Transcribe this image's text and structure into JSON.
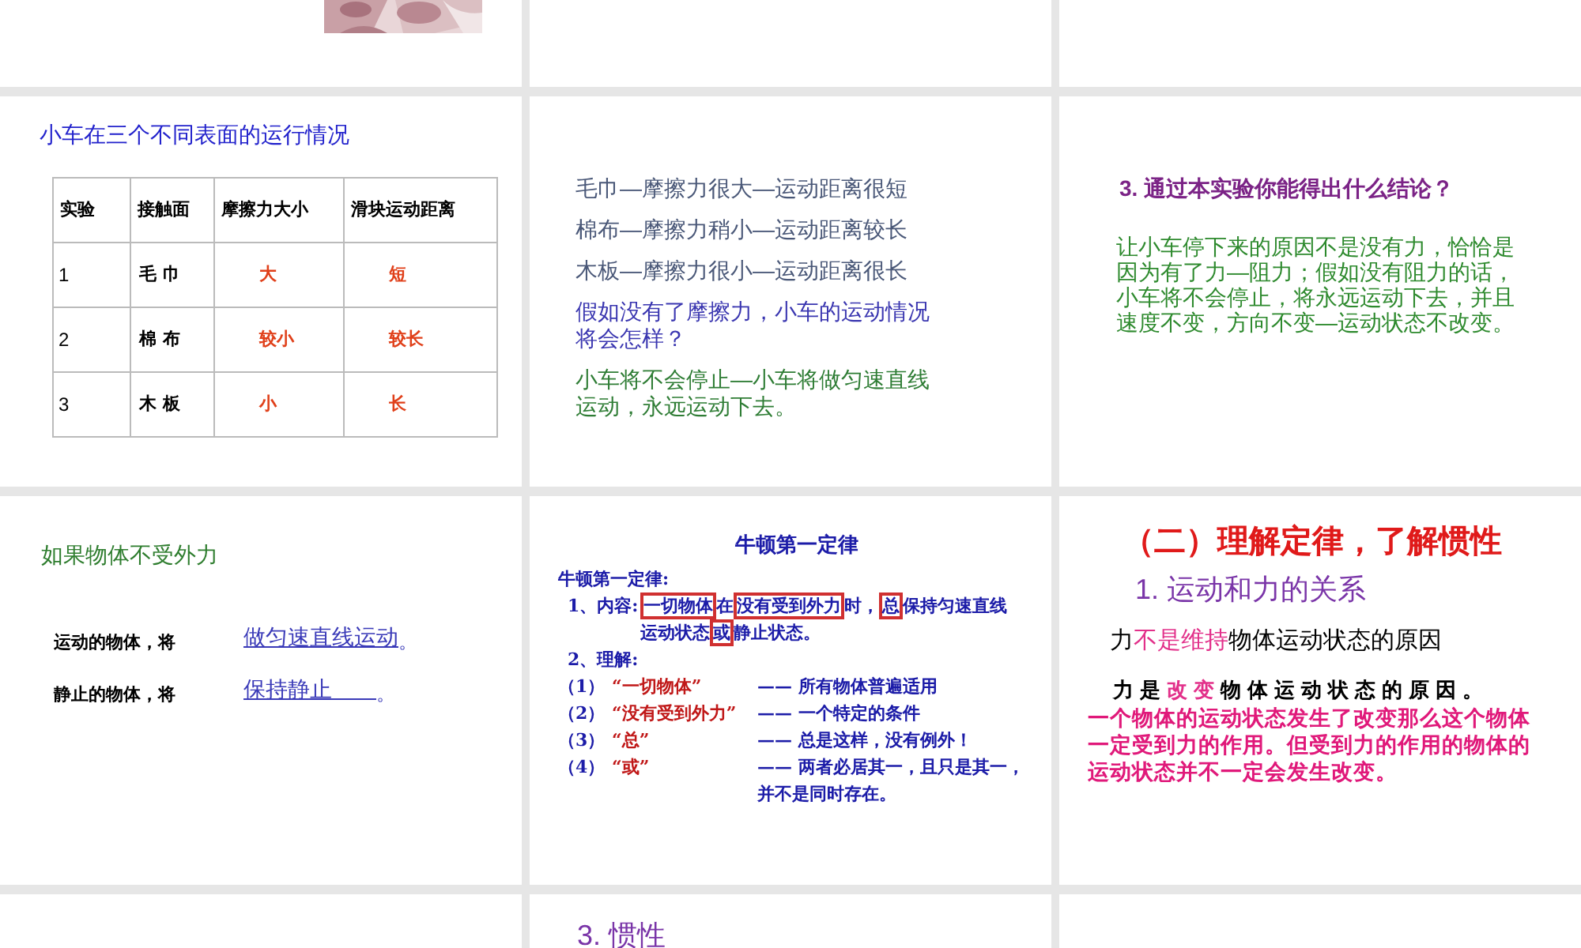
{
  "slides": [
    {
      "kind": "picture"
    },
    {
      "kind": "blank"
    },
    {
      "kind": "blank"
    },
    {
      "kind": "table",
      "title": "小车在三个不同表面的运行情况",
      "columns": [
        "实验",
        "接触面",
        "摩擦力大小",
        "滑块运动距离"
      ],
      "rows": [
        [
          "1",
          "毛 巾",
          "大",
          "短"
        ],
        [
          "2",
          "棉 布",
          "较小",
          "较长"
        ],
        [
          "3",
          "木 板",
          "小",
          "长"
        ]
      ]
    },
    {
      "kind": "lines",
      "lines": [
        {
          "color": "#4a5878",
          "text": "毛巾—摩擦力很大—运动距离很短"
        },
        {
          "color": "#4a5878",
          "text": "棉布—摩擦力稍小—运动距离较长"
        },
        {
          "color": "#4a5878",
          "text": "木板—摩擦力很小—运动距离很长"
        },
        {
          "color": "#3a36b0",
          "text": "假如没有了摩擦力，小车的运动情况将会怎样？"
        },
        {
          "color": "#2f7d35",
          "text": "小车将不会停止—小车将做匀速直线运动，永远运动下去。"
        }
      ]
    },
    {
      "kind": "conclusion",
      "title": "3. 通过本实验你能得出什么结论？",
      "body": "让小车停下来的原因不是没有力，恰恰是因为有了力—阻力；假如没有阻力的话，小车将不会停止，将永远运动下去，并且速度不变，方向不变—运动状态不改变。"
    },
    {
      "kind": "fill",
      "title": "如果物体不受外力",
      "items": [
        {
          "prompt": "运动的物体，将",
          "answer": "做匀速直线运动",
          "end": "。"
        },
        {
          "prompt": "静止的物体，将",
          "answer": "保持静止　　",
          "end": "。"
        }
      ]
    },
    {
      "kind": "law",
      "title": "牛顿第一定律",
      "heading": "牛顿第一定律:",
      "content_label": "1、内容:",
      "content": [
        {
          "text": "一切物体",
          "boxed": true
        },
        {
          "text": "在",
          "boxed": false
        },
        {
          "text": "没有受到外力",
          "boxed": true
        },
        {
          "text": "时，",
          "boxed": false
        },
        {
          "text": "总",
          "boxed": true
        },
        {
          "text": "保持匀速直线运动状态",
          "boxed": false
        },
        {
          "text": "或",
          "boxed": true
        },
        {
          "text": "静止状态。",
          "boxed": false
        }
      ],
      "understanding": "2、理解:",
      "items": [
        {
          "number": "（1）",
          "label": "“一切物体”",
          "text": "—— 所有物体普遍适用"
        },
        {
          "number": "（2）",
          "label": "“没有受到外力”",
          "text": "—— 一个特定的条件"
        },
        {
          "number": "（3）",
          "label": "“总”",
          "text": "—— 总是这样，没有例外！"
        },
        {
          "number": "（4）",
          "label": "“或”",
          "text": "—— 两者必居其一，且只是其一，并不是同时存在。"
        }
      ]
    },
    {
      "kind": "relation",
      "title": "（二）理解定律，了解惯性",
      "subtitle": "1. 运动和力的关系",
      "line_1": [
        {
          "text": "力",
          "emphasis": false
        },
        {
          "text": "不是维持",
          "emphasis": true
        },
        {
          "text": "物体运动状态的原因",
          "emphasis": false
        }
      ],
      "line_2": [
        {
          "text": "力是",
          "emphasis": false
        },
        {
          "text": "改变",
          "emphasis": true
        },
        {
          "text": "物体运动状态的原因。",
          "emphasis": false
        }
      ],
      "note": "一个物体的运动状态发生了改变那么这个物体一定受到力的作用。但受到力的作用的物体的运动状态并不一定会发生改变。"
    },
    {
      "kind": "blank"
    },
    {
      "kind": "heading",
      "title": "3. 惯性"
    },
    {
      "kind": "blank"
    }
  ]
}
